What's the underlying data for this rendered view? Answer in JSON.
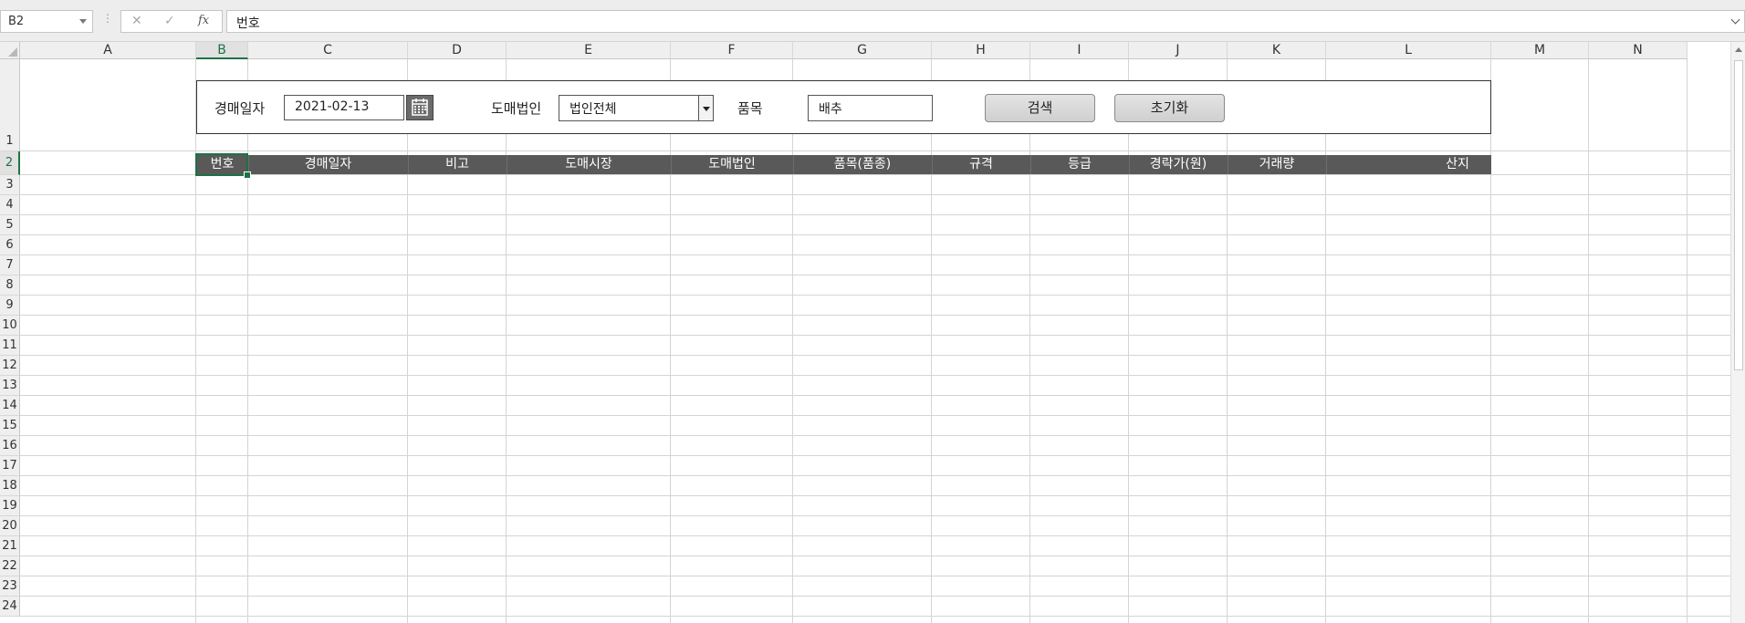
{
  "formula_bar": {
    "name_box": "B2",
    "more_icon": "⋮",
    "cancel_icon": "✕",
    "enter_icon": "✓",
    "fx_label": "fx",
    "formula_value": "번호"
  },
  "columns": [
    "A",
    "B",
    "C",
    "D",
    "E",
    "F",
    "G",
    "H",
    "I",
    "J",
    "K",
    "L",
    "M",
    "N"
  ],
  "selected_column": "B",
  "rows": [
    "1",
    "2",
    "3",
    "4",
    "5",
    "6",
    "7",
    "8",
    "9",
    "10",
    "11",
    "12",
    "13",
    "14",
    "15",
    "16",
    "17",
    "18",
    "19",
    "20",
    "21",
    "22",
    "23",
    "24"
  ],
  "selected_row": "2",
  "search_panel": {
    "auction_date_label": "경매일자",
    "auction_date_value": "2021-02-13",
    "calendar_icon": "calendar-icon",
    "corp_label": "도매법인",
    "corp_value": "법인전체",
    "item_label": "품목",
    "item_value": "배추",
    "search_button": "검색",
    "reset_button": "초기화"
  },
  "table_headers": [
    "번호",
    "경매일자",
    "비고",
    "도매시장",
    "도매법인",
    "품목(품종)",
    "규격",
    "등급",
    "경락가(원)",
    "거래량",
    "산지"
  ],
  "colors": {
    "header_bg": "#595959",
    "selection": "#217346"
  }
}
